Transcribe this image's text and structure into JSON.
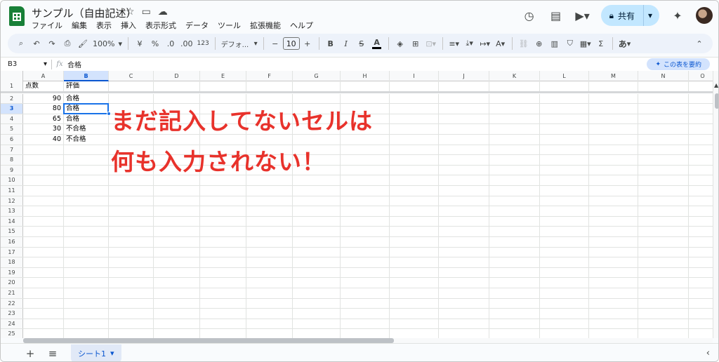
{
  "app": {
    "doc_title": "サンプル（自由記述）",
    "menu": [
      "ファイル",
      "編集",
      "表示",
      "挿入",
      "表示形式",
      "データ",
      "ツール",
      "拡張機能",
      "ヘルプ"
    ],
    "share_label": "共有"
  },
  "toolbar": {
    "zoom": "100%",
    "currency": "¥",
    "percent": "%",
    "dec_decrease": ".0",
    "dec_increase": ".00",
    "number_format": "123",
    "font_name": "デフォ...",
    "font_size": "10",
    "bold": "B",
    "italic": "I",
    "strike": "S",
    "text_color": "A",
    "ime": "あ"
  },
  "formula_bar": {
    "cell_ref": "B3",
    "content": "合格",
    "summarize_label": "この表を要約"
  },
  "columns": [
    "A",
    "B",
    "C",
    "D",
    "E",
    "F",
    "G",
    "H",
    "I",
    "J",
    "K",
    "L",
    "M",
    "N",
    "O"
  ],
  "rows": [
    "1",
    "2",
    "3",
    "4",
    "5",
    "6",
    "7",
    "8",
    "9",
    "10",
    "11",
    "12",
    "13",
    "14",
    "15",
    "16",
    "17",
    "18",
    "19",
    "20",
    "21",
    "22",
    "23",
    "24",
    "25"
  ],
  "cells": {
    "header": [
      "点数",
      "評価"
    ],
    "data": [
      {
        "score": "90",
        "grade": "合格"
      },
      {
        "score": "80",
        "grade": "合格"
      },
      {
        "score": "65",
        "grade": "合格"
      },
      {
        "score": "30",
        "grade": "不合格"
      },
      {
        "score": "40",
        "grade": "不合格"
      }
    ]
  },
  "annotation": {
    "line1": "まだ記入してないセルは",
    "line2": "何も入力されない！",
    "color": "#e8322b"
  },
  "sheets": [
    {
      "name": "シート1",
      "active": true
    }
  ]
}
